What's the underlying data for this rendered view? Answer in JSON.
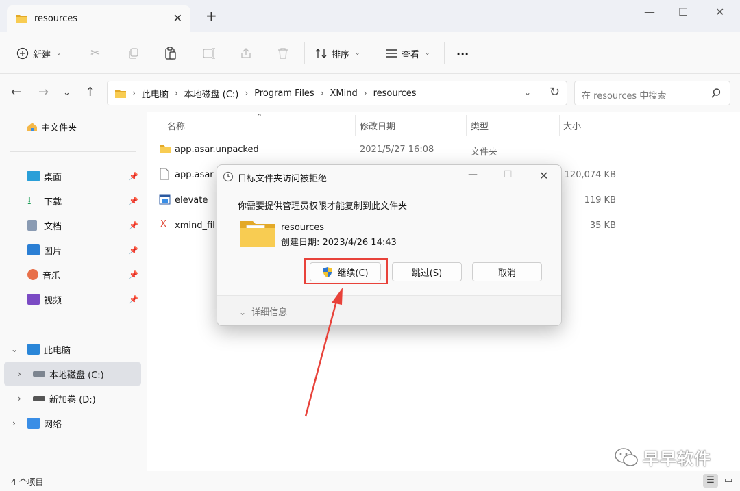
{
  "tab": {
    "title": "resources"
  },
  "toolbar": {
    "new_label": "新建",
    "sort_label": "排序",
    "view_label": "查看",
    "more_label": "···"
  },
  "address": {
    "crumbs": [
      "此电脑",
      "本地磁盘 (C:)",
      "Program Files",
      "XMind",
      "resources"
    ],
    "search_placeholder": "在 resources 中搜索"
  },
  "sidebar": {
    "home": "主文件夹",
    "quick": [
      "桌面",
      "下载",
      "文档",
      "图片",
      "音乐",
      "视频"
    ],
    "this_pc": "此电脑",
    "drives": [
      "本地磁盘 (C:)",
      "新加卷 (D:)"
    ],
    "network": "网络"
  },
  "columns": {
    "name": "名称",
    "modified": "修改日期",
    "type": "类型",
    "size": "大小"
  },
  "files": [
    {
      "name": "app.asar.unpacked",
      "modified": "2021/5/27 16:08",
      "type": "文件夹",
      "size": ""
    },
    {
      "name": "app.asar",
      "modified": "",
      "type": "",
      "size": "120,074 KB"
    },
    {
      "name": "elevate",
      "modified": "",
      "type": "",
      "size": "119 KB"
    },
    {
      "name": "xmind_fil",
      "modified": "",
      "type": "",
      "size": "35 KB"
    }
  ],
  "status": {
    "item_count": "4 个项目"
  },
  "dialog": {
    "title": "目标文件夹访问被拒绝",
    "message": "你需要提供管理员权限才能复制到此文件夹",
    "folder_name": "resources",
    "created": "创建日期: 2023/4/26 14:43",
    "continue_label": "继续(C)",
    "skip_label": "跳过(S)",
    "cancel_label": "取消",
    "details_label": "详细信息"
  },
  "watermark": {
    "text": "早早软件"
  },
  "colors": {
    "folder": "#f2c14e",
    "accent": "#0067c0",
    "annotation": "#e8423a"
  }
}
